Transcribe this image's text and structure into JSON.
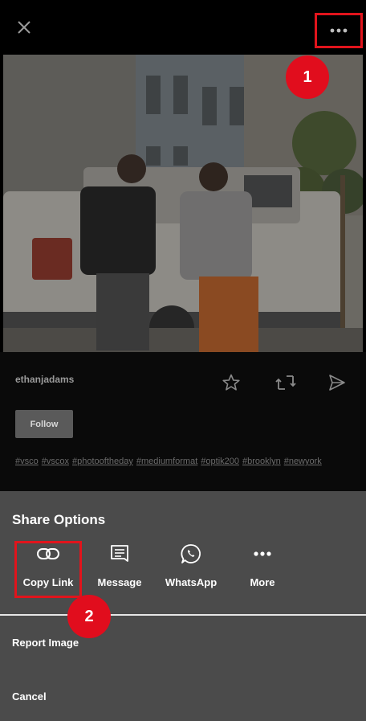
{
  "header": {
    "close_icon": "close-icon",
    "more_icon": "ellipsis-icon"
  },
  "markers": {
    "step1": "1",
    "step2": "2"
  },
  "post": {
    "username": "ethanjadams",
    "actions": [
      "star-icon",
      "repost-icon",
      "send-icon"
    ],
    "follow_label": "Follow",
    "tags": [
      "#vsco",
      "#vscox",
      "#photooftheday",
      "#mediumformat",
      "#optik200",
      "#brooklyn",
      "#newyork"
    ]
  },
  "share_sheet": {
    "title": "Share Options",
    "options": [
      {
        "label": "Copy Link",
        "icon": "link-icon"
      },
      {
        "label": "Message",
        "icon": "message-icon"
      },
      {
        "label": "WhatsApp",
        "icon": "whatsapp-icon"
      },
      {
        "label": "More",
        "icon": "ellipsis-icon"
      }
    ],
    "report_label": "Report Image",
    "cancel_label": "Cancel"
  },
  "colors": {
    "highlight": "#e1141c",
    "sheet_bg": "#4b4b4b",
    "background": "#000000"
  }
}
